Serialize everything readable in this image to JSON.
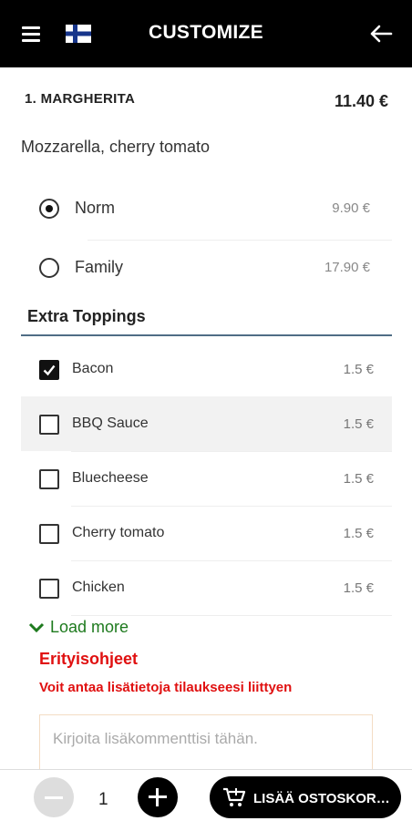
{
  "header": {
    "title": "CUSTOMIZE"
  },
  "item": {
    "name": "1. MARGHERITA",
    "price": "11.40 €",
    "description": "Mozzarella, cherry tomato"
  },
  "sizes": [
    {
      "label": "Norm",
      "price": "9.90 €",
      "selected": true
    },
    {
      "label": "Family",
      "price": "17.90 €",
      "selected": false
    }
  ],
  "extras": {
    "title": "Extra Toppings",
    "items": [
      {
        "label": "Bacon",
        "price": "1.5 €",
        "checked": true
      },
      {
        "label": "BBQ Sauce",
        "price": "1.5 €",
        "checked": false
      },
      {
        "label": "Bluecheese",
        "price": "1.5 €",
        "checked": false
      },
      {
        "label": "Cherry tomato",
        "price": "1.5 €",
        "checked": false
      },
      {
        "label": "Chicken",
        "price": "1.5 €",
        "checked": false
      }
    ],
    "load_more": "Load more"
  },
  "special": {
    "title": "Erityisohjeet",
    "subtitle": "Voit antaa lisätietoja tilaukseesi liittyen",
    "placeholder": "Kirjoita lisäkommenttisi tähän."
  },
  "footer": {
    "quantity": "1",
    "add_to_cart_label": "LISÄÄ OSTOSKORIIN"
  },
  "colors": {
    "header_bg": "#000000",
    "accent_green": "#1e7a1e",
    "accent_red": "#e01010",
    "section_line": "#4f6d85"
  }
}
